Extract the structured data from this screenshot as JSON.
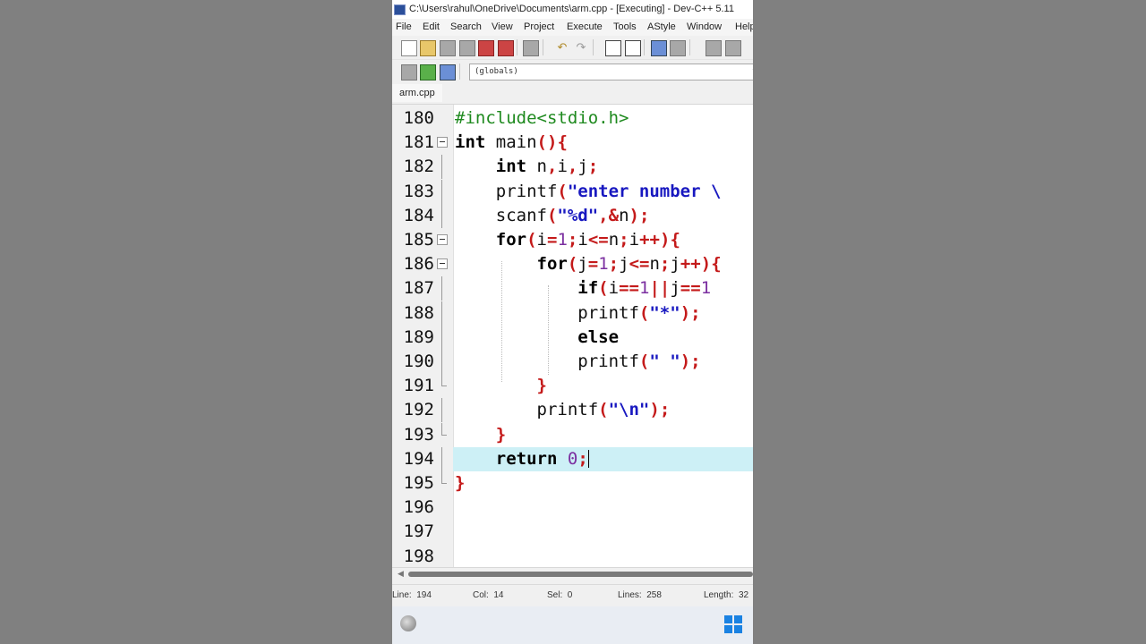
{
  "window": {
    "title": "C:\\Users\\rahul\\OneDrive\\Documents\\arm.cpp - [Executing] - Dev-C++ 5.11"
  },
  "menu": {
    "items": [
      "File",
      "Edit",
      "Search",
      "View",
      "Project",
      "Execute",
      "Tools",
      "AStyle",
      "Window",
      "Help"
    ]
  },
  "toolbar": {
    "scope_value": "(globals)"
  },
  "tabs": [
    {
      "label": "arm.cpp"
    }
  ],
  "editor": {
    "current_line": 194,
    "lines": [
      {
        "number": "180",
        "text": "#include<stdio.h>"
      },
      {
        "number": "181",
        "text": "int main(){"
      },
      {
        "number": "182",
        "text": "int n,i,j;"
      },
      {
        "number": "183",
        "text": "printf(\"enter number \\"
      },
      {
        "number": "184",
        "text": "scanf(\"%d\",&n);"
      },
      {
        "number": "185",
        "text": "for(i=1;i<=n;i++){"
      },
      {
        "number": "186",
        "text": "for(j=1;j<=n;j++){"
      },
      {
        "number": "187",
        "text": "if(i==1||j==1"
      },
      {
        "number": "188",
        "text": "printf(\"*\");"
      },
      {
        "number": "189",
        "text": "else"
      },
      {
        "number": "190",
        "text": "printf(\" \");"
      },
      {
        "number": "191",
        "text": "}"
      },
      {
        "number": "192",
        "text": "printf(\"\\n\");"
      },
      {
        "number": "193",
        "text": "}"
      },
      {
        "number": "194",
        "text": "return 0;"
      },
      {
        "number": "195",
        "text": "}"
      },
      {
        "number": "196",
        "text": ""
      },
      {
        "number": "197",
        "text": ""
      },
      {
        "number": "198",
        "text": ""
      }
    ]
  },
  "status": {
    "line_label": "Line:",
    "line_value": "194",
    "col_label": "Col:",
    "col_value": "14",
    "sel_label": "Sel:",
    "sel_value": "0",
    "lines_label": "Lines:",
    "lines_value": "258",
    "length_label": "Length:",
    "length_value": "32"
  },
  "icons": {
    "taskbar_left": "devcpp-ball-icon",
    "taskbar_right": "windows-start-icon"
  }
}
